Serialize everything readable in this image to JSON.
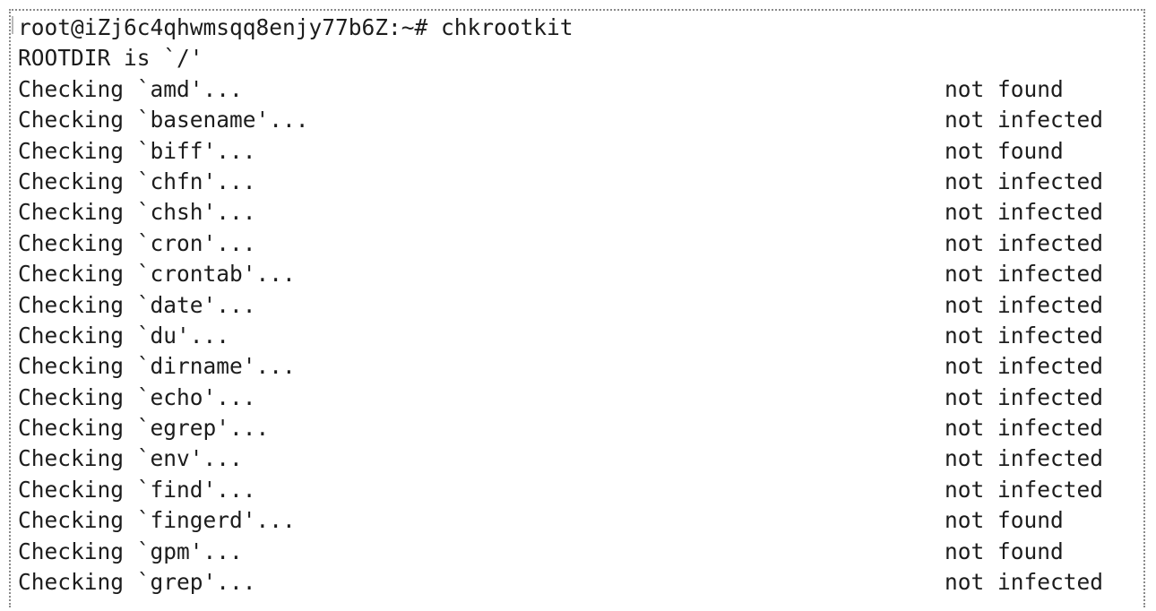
{
  "terminal": {
    "prompt": "root@iZj6c4qhwmsqq8enjy77b6Z:~# chkrootkit",
    "rootdir": "ROOTDIR is `/'",
    "checks": [
      {
        "label": "Checking `amd'...",
        "result": "not found"
      },
      {
        "label": "Checking `basename'...",
        "result": "not infected"
      },
      {
        "label": "Checking `biff'...",
        "result": "not found"
      },
      {
        "label": "Checking `chfn'...",
        "result": "not infected"
      },
      {
        "label": "Checking `chsh'...",
        "result": "not infected"
      },
      {
        "label": "Checking `cron'...",
        "result": "not infected"
      },
      {
        "label": "Checking `crontab'...",
        "result": "not infected"
      },
      {
        "label": "Checking `date'...",
        "result": "not infected"
      },
      {
        "label": "Checking `du'...",
        "result": "not infected"
      },
      {
        "label": "Checking `dirname'...",
        "result": "not infected"
      },
      {
        "label": "Checking `echo'...",
        "result": "not infected"
      },
      {
        "label": "Checking `egrep'...",
        "result": "not infected"
      },
      {
        "label": "Checking `env'...",
        "result": "not infected"
      },
      {
        "label": "Checking `find'...",
        "result": "not infected"
      },
      {
        "label": "Checking `fingerd'...",
        "result": "not found"
      },
      {
        "label": "Checking `gpm'...",
        "result": "not found"
      },
      {
        "label": "Checking `grep'...",
        "result": "not infected"
      }
    ],
    "text_color": "#1c1c1c",
    "border_color": "#8a8a8a"
  }
}
